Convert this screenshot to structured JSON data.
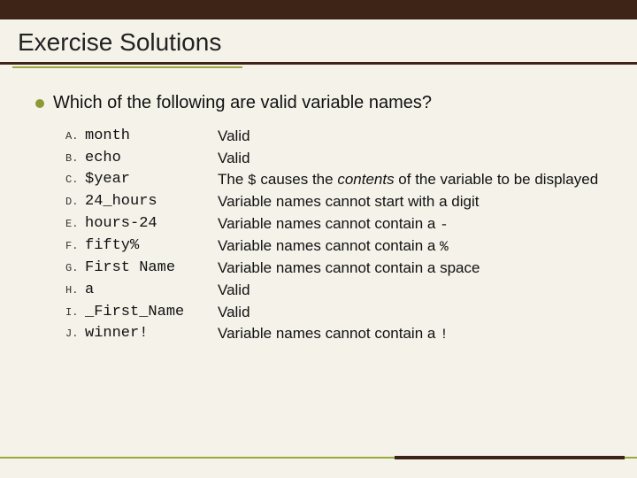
{
  "title": "Exercise Solutions",
  "question": "Which of the following are valid variable names?",
  "rows": [
    {
      "letter": "A.",
      "name": "month",
      "explain_html": "Valid"
    },
    {
      "letter": "B.",
      "name": "echo",
      "explain_html": "Valid"
    },
    {
      "letter": "C.",
      "name": "$year",
      "explain_html": "The <code>$</code> causes the <em>contents</em> of the variable to be displayed"
    },
    {
      "letter": "D.",
      "name": "24_hours",
      "explain_html": "Variable names cannot start with a digit"
    },
    {
      "letter": "E.",
      "name": "hours-24",
      "explain_html": "Variable names cannot contain a <code>-</code>"
    },
    {
      "letter": "F.",
      "name": "fifty%",
      "explain_html": "Variable names cannot contain a <code>%</code>"
    },
    {
      "letter": "G.",
      "name": "First Name",
      "explain_html": "Variable names cannot contain a space"
    },
    {
      "letter": "H.",
      "name": "a",
      "explain_html": "Valid"
    },
    {
      "letter": "I.",
      "name": "_First_Name",
      "explain_html": "Valid"
    },
    {
      "letter": "J.",
      "name": "winner!",
      "explain_html": "Variable names cannot contain a <code>!</code>"
    }
  ]
}
